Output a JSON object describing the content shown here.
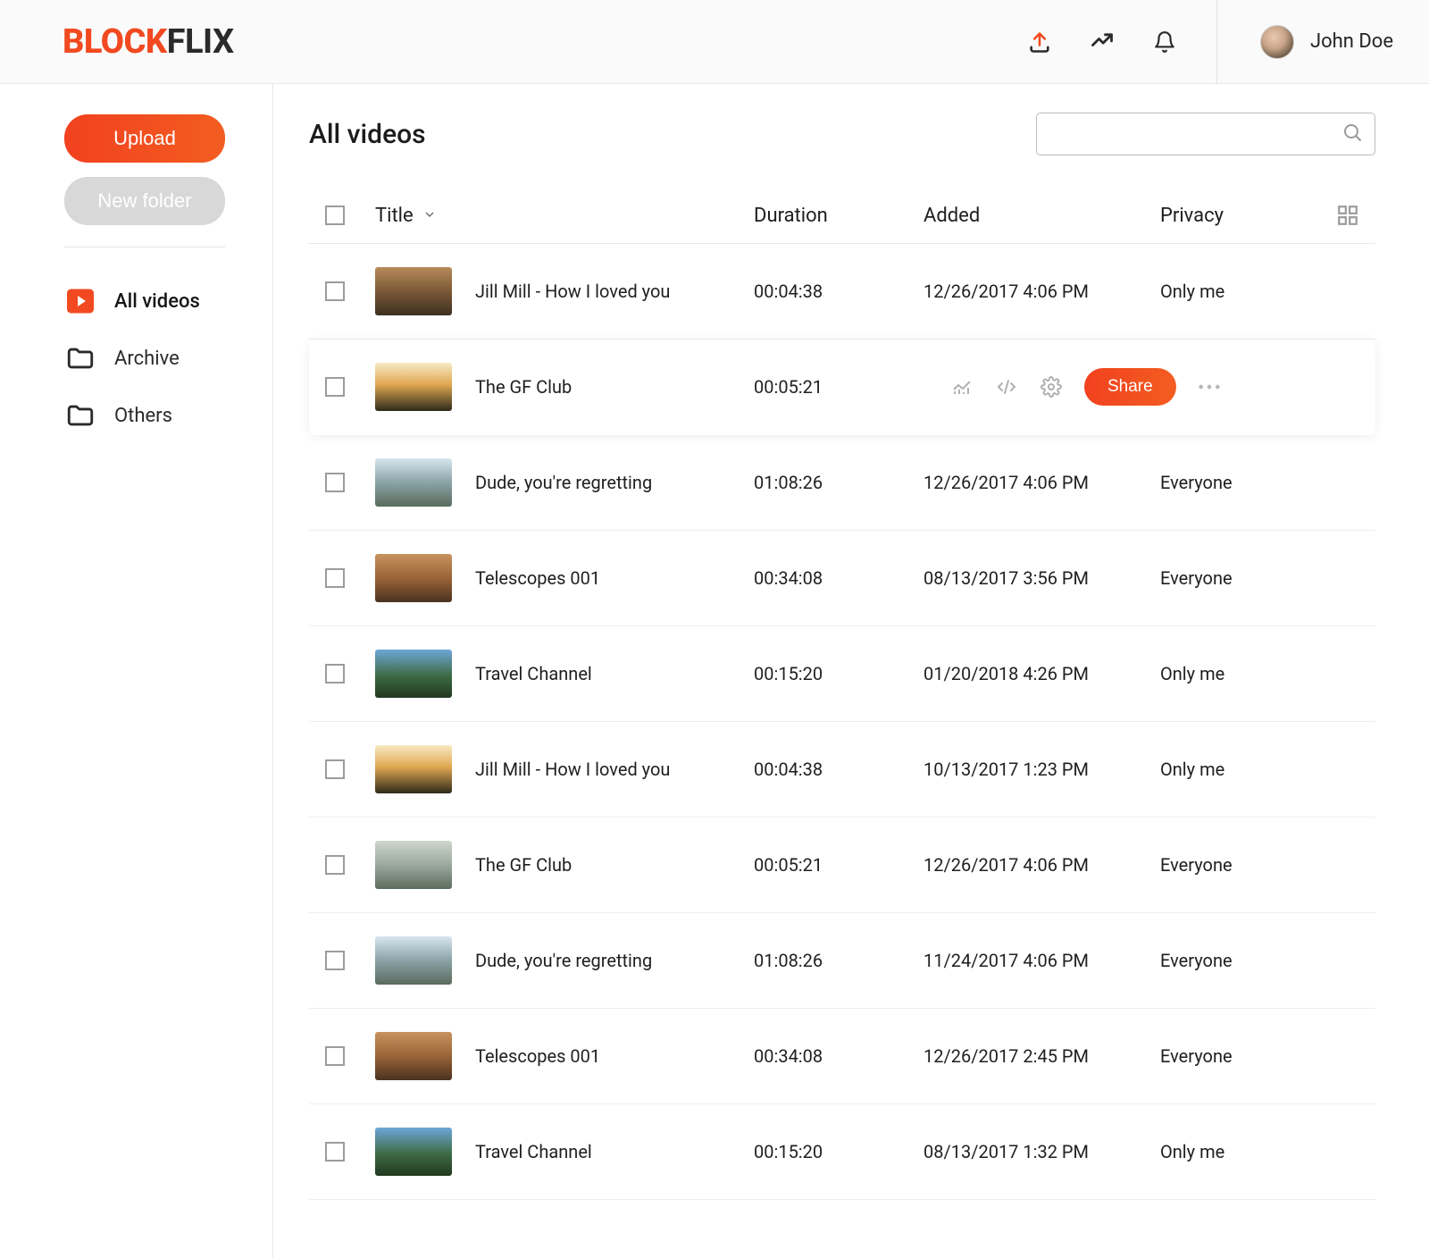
{
  "brand": {
    "part1": "BLOCK",
    "part2": "FLIX"
  },
  "user": {
    "name": "John Doe"
  },
  "sidebar": {
    "upload": "Upload",
    "newFolder": "New folder",
    "nav": [
      {
        "label": "All videos"
      },
      {
        "label": "Archive"
      },
      {
        "label": "Others"
      }
    ]
  },
  "page": {
    "title": "All videos"
  },
  "search": {
    "placeholder": ""
  },
  "columns": {
    "title": "Title",
    "duration": "Duration",
    "added": "Added",
    "privacy": "Privacy"
  },
  "actions": {
    "share": "Share"
  },
  "videos": [
    {
      "title": "Jill Mill - How I loved you",
      "duration": "00:04:38",
      "added": "12/26/2017 4:06 PM",
      "privacy": "Only me",
      "thumb": "t1"
    },
    {
      "title": "The GF Club",
      "duration": "00:05:21",
      "added": "",
      "privacy": "",
      "thumb": "t2",
      "hover": true
    },
    {
      "title": "Dude, you're regretting",
      "duration": "01:08:26",
      "added": "12/26/2017 4:06 PM",
      "privacy": "Everyone",
      "thumb": "t3"
    },
    {
      "title": "Telescopes 001",
      "duration": "00:34:08",
      "added": "08/13/2017 3:56 PM",
      "privacy": "Everyone",
      "thumb": "t4"
    },
    {
      "title": "Travel Channel",
      "duration": "00:15:20",
      "added": "01/20/2018 4:26 PM",
      "privacy": "Only me",
      "thumb": "t5"
    },
    {
      "title": "Jill Mill - How I loved you",
      "duration": "00:04:38",
      "added": "10/13/2017 1:23 PM",
      "privacy": "Only me",
      "thumb": "t2"
    },
    {
      "title": "The GF Club",
      "duration": "00:05:21",
      "added": "12/26/2017 4:06 PM",
      "privacy": "Everyone",
      "thumb": "t6"
    },
    {
      "title": "Dude, you're regretting",
      "duration": "01:08:26",
      "added": "11/24/2017 4:06 PM",
      "privacy": "Everyone",
      "thumb": "t3"
    },
    {
      "title": "Telescopes 001",
      "duration": "00:34:08",
      "added": "12/26/2017 2:45 PM",
      "privacy": "Everyone",
      "thumb": "t4"
    },
    {
      "title": "Travel Channel",
      "duration": "00:15:20",
      "added": "08/13/2017 1:32 PM",
      "privacy": "Only me",
      "thumb": "t5"
    }
  ]
}
